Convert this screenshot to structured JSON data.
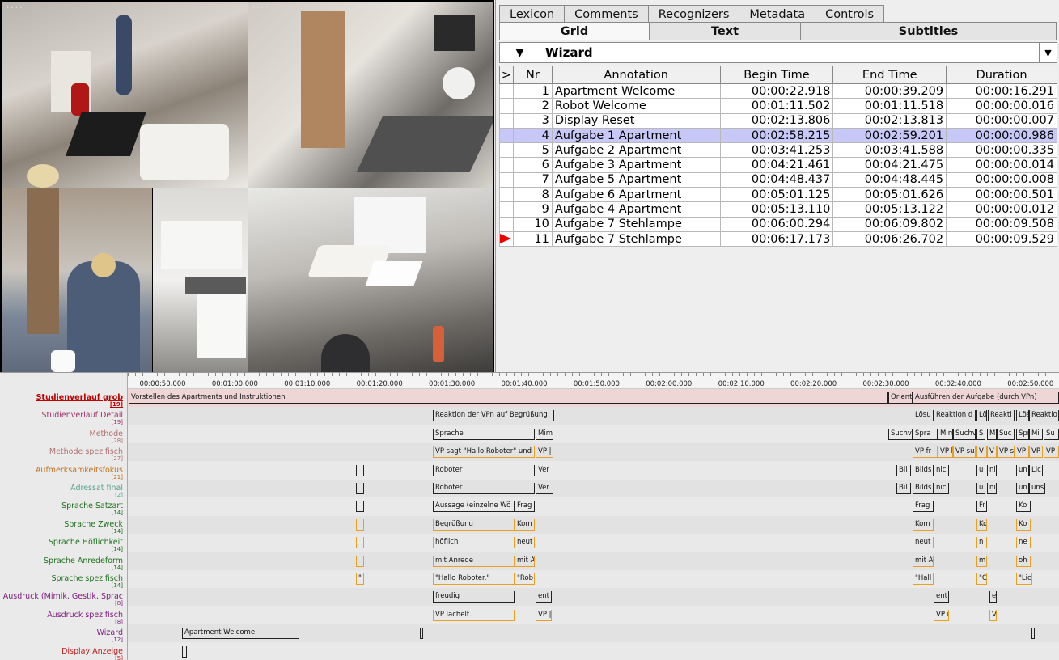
{
  "videos": [
    {
      "id": "cam1",
      "label": "...."
    },
    {
      "id": "cam2",
      "label": "...."
    },
    {
      "id": "cam3",
      "label": ""
    },
    {
      "id": "cam4",
      "label": ""
    },
    {
      "id": "cam5",
      "label": "...."
    }
  ],
  "tabs_top": [
    "Lexicon",
    "Comments",
    "Recognizers",
    "Metadata",
    "Controls"
  ],
  "tabs_second": [
    "Grid",
    "Text",
    "Subtitles"
  ],
  "active_tab": "Grid",
  "tier_selector": {
    "arrow": "▼",
    "name": "Wizard",
    "dropdown": "▼"
  },
  "grid": {
    "headers": [
      ">",
      "Nr",
      "Annotation",
      "Begin Time",
      "End Time",
      "Duration"
    ],
    "rows": [
      {
        "nr": "1",
        "annotation": "Apartment Welcome",
        "begin": "00:00:22.918",
        "end": "00:00:39.209",
        "duration": "00:00:16.291"
      },
      {
        "nr": "2",
        "annotation": "Robot Welcome",
        "begin": "00:01:11.502",
        "end": "00:01:11.518",
        "duration": "00:00:00.016"
      },
      {
        "nr": "3",
        "annotation": "Display Reset",
        "begin": "00:02:13.806",
        "end": "00:02:13.813",
        "duration": "00:00:00.007"
      },
      {
        "nr": "4",
        "annotation": "Aufgabe 1 Apartment",
        "begin": "00:02:58.215",
        "end": "00:02:59.201",
        "duration": "00:00:00.986"
      },
      {
        "nr": "5",
        "annotation": "Aufgabe 2 Apartment",
        "begin": "00:03:41.253",
        "end": "00:03:41.588",
        "duration": "00:00:00.335"
      },
      {
        "nr": "6",
        "annotation": "Aufgabe 3 Apartment",
        "begin": "00:04:21.461",
        "end": "00:04:21.475",
        "duration": "00:00:00.014"
      },
      {
        "nr": "7",
        "annotation": "Aufgabe 5 Apartment",
        "begin": "00:04:48.437",
        "end": "00:04:48.445",
        "duration": "00:00:00.008"
      },
      {
        "nr": "8",
        "annotation": "Aufgabe 6 Apartment",
        "begin": "00:05:01.125",
        "end": "00:05:01.626",
        "duration": "00:00:00.501"
      },
      {
        "nr": "9",
        "annotation": "Aufgabe 4 Apartment",
        "begin": "00:05:13.110",
        "end": "00:05:13.122",
        "duration": "00:00:00.012"
      },
      {
        "nr": "10",
        "annotation": "Aufgabe 7 Stehlampe",
        "begin": "00:06:00.294",
        "end": "00:06:09.802",
        "duration": "00:00:09.508"
      },
      {
        "nr": "11",
        "annotation": "Aufgabe 7 Stehlampe",
        "begin": "00:06:17.173",
        "end": "00:06:26.702",
        "duration": "00:00:09.529"
      }
    ],
    "selected_row": 4
  },
  "timeline": {
    "ticks": [
      "00:00:50.000",
      "00:01:00.000",
      "00:01:10.000",
      "00:01:20.000",
      "00:01:30.000",
      "00:01:40.000",
      "00:01:50.000",
      "00:02:00.000",
      "00:02:10.000",
      "00:02:20.000",
      "00:02:30.000",
      "00:02:40.000",
      "00:02:50.000"
    ],
    "tiers": [
      {
        "name": "Studienverlauf grob",
        "count": "[19]",
        "color": "#c00000",
        "bold": true
      },
      {
        "name": "Studienverlauf Detail",
        "count": "[19]",
        "color": "#a0306a"
      },
      {
        "name": "Methode",
        "count": "[28]",
        "color": "#b07070"
      },
      {
        "name": "Methode spezifisch",
        "count": "[27]",
        "color": "#b07070"
      },
      {
        "name": "Aufmerksamkeitsfokus",
        "count": "[21]",
        "color": "#c07020"
      },
      {
        "name": "Adressat final",
        "count": "[2]",
        "color": "#5aa090"
      },
      {
        "name": "Sprache Satzart",
        "count": "[14]",
        "color": "#207020"
      },
      {
        "name": "Sprache Zweck",
        "count": "[14]",
        "color": "#207020"
      },
      {
        "name": "Sprache Höflichkeit",
        "count": "[14]",
        "color": "#207020"
      },
      {
        "name": "Sprache Anredeform",
        "count": "[14]",
        "color": "#207020"
      },
      {
        "name": "Sprache spezifisch",
        "count": "[14]",
        "color": "#207020"
      },
      {
        "name": "Ausdruck (Mimik, Gestik, Sprac",
        "count": "[8]",
        "color": "#802080"
      },
      {
        "name": "Ausdruck spezifisch",
        "count": "[8]",
        "color": "#802080"
      },
      {
        "name": "Wizard",
        "count": "[12]",
        "color": "#802080"
      },
      {
        "name": "Display Anzeige",
        "count": "[5]",
        "color": "#c02020"
      }
    ],
    "annotations": [
      {
        "tier": 0,
        "start": 1,
        "end": 940,
        "text": "Vorstellen des Apartments und Instruktionen"
      },
      {
        "tier": 0,
        "start": 940,
        "end": 970,
        "text": "Orient"
      },
      {
        "tier": 0,
        "start": 970,
        "end": 1151,
        "text": "Ausführen der Aufgabe (durch VPn)"
      },
      {
        "tier": 1,
        "start": 377,
        "end": 527,
        "text": "Reaktion der VPn auf Begrüßung"
      },
      {
        "tier": 1,
        "start": 970,
        "end": 996,
        "text": "Lösu"
      },
      {
        "tier": 1,
        "start": 996,
        "end": 1048,
        "text": "Reaktion d"
      },
      {
        "tier": 1,
        "start": 1049,
        "end": 1062,
        "text": "Lö"
      },
      {
        "tier": 1,
        "start": 1063,
        "end": 1096,
        "text": "Reakti"
      },
      {
        "tier": 1,
        "start": 1098,
        "end": 1114,
        "text": "Lös"
      },
      {
        "tier": 1,
        "start": 1114,
        "end": 1151,
        "text": "Reaktio"
      },
      {
        "tier": 2,
        "start": 377,
        "end": 503,
        "text": "Sprache"
      },
      {
        "tier": 2,
        "start": 504,
        "end": 526,
        "text": "Mim"
      },
      {
        "tier": 2,
        "start": 940,
        "end": 970,
        "text": "Suchv"
      },
      {
        "tier": 2,
        "start": 970,
        "end": 1001,
        "text": "Spra"
      },
      {
        "tier": 2,
        "start": 1001,
        "end": 1020,
        "text": "Mim"
      },
      {
        "tier": 2,
        "start": 1020,
        "end": 1048,
        "text": "Suchv"
      },
      {
        "tier": 2,
        "start": 1049,
        "end": 1060,
        "text": "S"
      },
      {
        "tier": 2,
        "start": 1062,
        "end": 1074,
        "text": "M"
      },
      {
        "tier": 2,
        "start": 1074,
        "end": 1096,
        "text": "Suc"
      },
      {
        "tier": 2,
        "start": 1098,
        "end": 1114,
        "text": "Spr"
      },
      {
        "tier": 2,
        "start": 1114,
        "end": 1131,
        "text": "Mi"
      },
      {
        "tier": 2,
        "start": 1132,
        "end": 1151,
        "text": "Su"
      },
      {
        "tier": 3,
        "start": 377,
        "end": 503,
        "text": "VP sagt \"Hallo Roboter\" und",
        "orange": true
      },
      {
        "tier": 3,
        "start": 504,
        "end": 526,
        "text": "VP |",
        "orange": true
      },
      {
        "tier": 3,
        "start": 970,
        "end": 1001,
        "text": "VP fr",
        "orange": true
      },
      {
        "tier": 3,
        "start": 1001,
        "end": 1020,
        "text": "VP l",
        "orange": true
      },
      {
        "tier": 3,
        "start": 1020,
        "end": 1048,
        "text": "VP suc",
        "orange": true
      },
      {
        "tier": 3,
        "start": 1049,
        "end": 1062,
        "text": "V",
        "orange": true
      },
      {
        "tier": 3,
        "start": 1062,
        "end": 1074,
        "text": "V",
        "orange": true
      },
      {
        "tier": 3,
        "start": 1074,
        "end": 1096,
        "text": "VP s",
        "orange": true
      },
      {
        "tier": 3,
        "start": 1096,
        "end": 1114,
        "text": "VP",
        "orange": true
      },
      {
        "tier": 3,
        "start": 1114,
        "end": 1131,
        "text": "VP",
        "orange": true
      },
      {
        "tier": 3,
        "start": 1132,
        "end": 1151,
        "text": "VP",
        "orange": true
      },
      {
        "tier": 4,
        "start": 282,
        "end": 292,
        "text": ""
      },
      {
        "tier": 4,
        "start": 377,
        "end": 503,
        "text": "Roboter"
      },
      {
        "tier": 4,
        "start": 504,
        "end": 526,
        "text": "Ver"
      },
      {
        "tier": 4,
        "start": 950,
        "end": 968,
        "text": "Bil"
      },
      {
        "tier": 4,
        "start": 970,
        "end": 996,
        "text": "Bilds"
      },
      {
        "tier": 4,
        "start": 996,
        "end": 1015,
        "text": "nic"
      },
      {
        "tier": 4,
        "start": 1049,
        "end": 1060,
        "text": "u"
      },
      {
        "tier": 4,
        "start": 1062,
        "end": 1074,
        "text": "ni"
      },
      {
        "tier": 4,
        "start": 1098,
        "end": 1114,
        "text": "un"
      },
      {
        "tier": 4,
        "start": 1114,
        "end": 1131,
        "text": "Lic"
      },
      {
        "tier": 5,
        "start": 282,
        "end": 292,
        "text": ""
      },
      {
        "tier": 5,
        "start": 377,
        "end": 503,
        "text": "Roboter"
      },
      {
        "tier": 5,
        "start": 504,
        "end": 526,
        "text": "Ver"
      },
      {
        "tier": 5,
        "start": 950,
        "end": 968,
        "text": "Bil"
      },
      {
        "tier": 5,
        "start": 970,
        "end": 996,
        "text": "Bilds"
      },
      {
        "tier": 5,
        "start": 996,
        "end": 1015,
        "text": "nic"
      },
      {
        "tier": 5,
        "start": 1049,
        "end": 1060,
        "text": "u"
      },
      {
        "tier": 5,
        "start": 1062,
        "end": 1074,
        "text": "ni"
      },
      {
        "tier": 5,
        "start": 1098,
        "end": 1114,
        "text": "un"
      },
      {
        "tier": 5,
        "start": 1114,
        "end": 1134,
        "text": "uns"
      },
      {
        "tier": 6,
        "start": 282,
        "end": 292,
        "text": ""
      },
      {
        "tier": 6,
        "start": 377,
        "end": 478,
        "text": "Aussage (einzelne Wö"
      },
      {
        "tier": 6,
        "start": 478,
        "end": 503,
        "text": "Frag"
      },
      {
        "tier": 6,
        "start": 970,
        "end": 996,
        "text": "Frag"
      },
      {
        "tier": 6,
        "start": 1049,
        "end": 1062,
        "text": "Fr"
      },
      {
        "tier": 6,
        "start": 1098,
        "end": 1116,
        "text": "Ko"
      },
      {
        "tier": 7,
        "start": 282,
        "end": 292,
        "text": "",
        "orange": true
      },
      {
        "tier": 7,
        "start": 377,
        "end": 478,
        "text": "Begrüßung",
        "orange": true
      },
      {
        "tier": 7,
        "start": 478,
        "end": 503,
        "text": "Kom",
        "orange": true
      },
      {
        "tier": 7,
        "start": 970,
        "end": 996,
        "text": "Kom",
        "orange": true
      },
      {
        "tier": 7,
        "start": 1049,
        "end": 1062,
        "text": "Ko",
        "orange": true
      },
      {
        "tier": 7,
        "start": 1098,
        "end": 1116,
        "text": "Ko",
        "orange": true
      },
      {
        "tier": 8,
        "start": 282,
        "end": 292,
        "text": "",
        "orange": true
      },
      {
        "tier": 8,
        "start": 377,
        "end": 478,
        "text": "höflich",
        "orange": true
      },
      {
        "tier": 8,
        "start": 478,
        "end": 503,
        "text": "neut",
        "orange": true
      },
      {
        "tier": 8,
        "start": 970,
        "end": 996,
        "text": "neut",
        "orange": true
      },
      {
        "tier": 8,
        "start": 1049,
        "end": 1062,
        "text": "n",
        "orange": true
      },
      {
        "tier": 8,
        "start": 1098,
        "end": 1116,
        "text": "ne",
        "orange": true
      },
      {
        "tier": 9,
        "start": 282,
        "end": 292,
        "text": "",
        "orange": true
      },
      {
        "tier": 9,
        "start": 377,
        "end": 478,
        "text": "mit Anrede",
        "orange": true
      },
      {
        "tier": 9,
        "start": 478,
        "end": 503,
        "text": "mit A",
        "orange": true
      },
      {
        "tier": 9,
        "start": 970,
        "end": 996,
        "text": "mit A",
        "orange": true
      },
      {
        "tier": 9,
        "start": 1049,
        "end": 1062,
        "text": "mi",
        "orange": true
      },
      {
        "tier": 9,
        "start": 1098,
        "end": 1116,
        "text": "oh",
        "orange": true
      },
      {
        "tier": 10,
        "start": 282,
        "end": 292,
        "text": "\"",
        "orange": true
      },
      {
        "tier": 10,
        "start": 377,
        "end": 478,
        "text": "\"Hallo Roboter.\"",
        "orange": true
      },
      {
        "tier": 10,
        "start": 478,
        "end": 503,
        "text": "\"Rob",
        "orange": true
      },
      {
        "tier": 10,
        "start": 970,
        "end": 996,
        "text": "\"Hall",
        "orange": true
      },
      {
        "tier": 10,
        "start": 1049,
        "end": 1062,
        "text": "\"C",
        "orange": true
      },
      {
        "tier": 10,
        "start": 1098,
        "end": 1118,
        "text": "\"Lic",
        "orange": true
      },
      {
        "tier": 11,
        "start": 377,
        "end": 478,
        "text": "freudig"
      },
      {
        "tier": 11,
        "start": 504,
        "end": 524,
        "text": "ent"
      },
      {
        "tier": 11,
        "start": 996,
        "end": 1015,
        "text": "ent"
      },
      {
        "tier": 11,
        "start": 1065,
        "end": 1074,
        "text": "e"
      },
      {
        "tier": 12,
        "start": 377,
        "end": 478,
        "text": "VP lächelt.",
        "orange": true
      },
      {
        "tier": 12,
        "start": 504,
        "end": 524,
        "text": "VP |",
        "orange": true
      },
      {
        "tier": 12,
        "start": 996,
        "end": 1015,
        "text": "VP i",
        "orange": true
      },
      {
        "tier": 12,
        "start": 1065,
        "end": 1074,
        "text": "V",
        "orange": true
      },
      {
        "tier": 13,
        "start": 67,
        "end": 212,
        "text": "Apartment Welcome"
      },
      {
        "tier": 13,
        "start": 361,
        "end": 362,
        "text": ""
      },
      {
        "tier": 13,
        "start": 1117,
        "end": 1121,
        "text": ""
      },
      {
        "tier": 14,
        "start": 67,
        "end": 73,
        "text": ""
      }
    ]
  }
}
